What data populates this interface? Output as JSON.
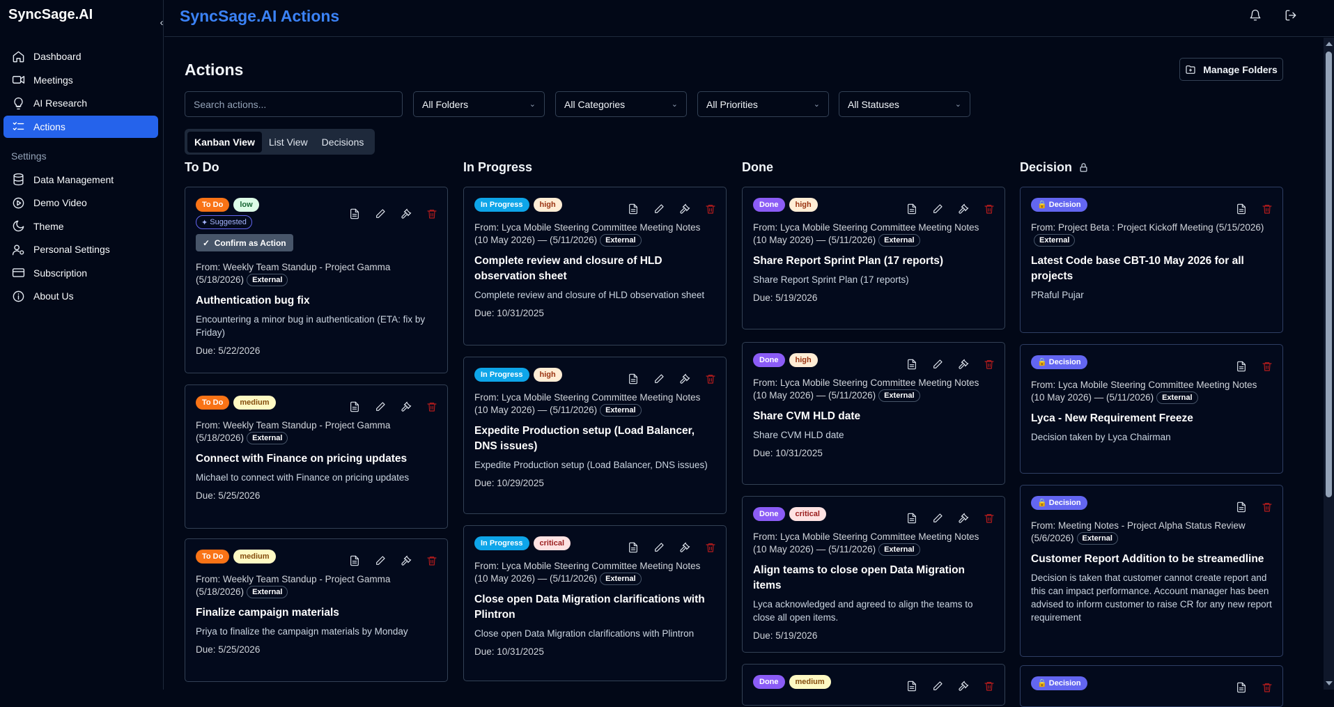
{
  "app": {
    "brand": "SyncSage.AI",
    "title": "SyncSage.AI Actions"
  },
  "nav": [
    {
      "label": "Dashboard"
    },
    {
      "label": "Meetings"
    },
    {
      "label": "AI Research"
    },
    {
      "label": "Actions"
    }
  ],
  "settings_label": "Settings",
  "settings_nav": [
    {
      "label": "Data Management"
    },
    {
      "label": "Demo Video"
    },
    {
      "label": "Theme"
    },
    {
      "label": "Personal Settings"
    },
    {
      "label": "Subscription"
    },
    {
      "label": "About Us"
    }
  ],
  "page": {
    "heading": "Actions",
    "manage_folders": "Manage Folders",
    "search_placeholder": "Search actions..."
  },
  "filters": [
    "All Folders",
    "All Categories",
    "All Priorities",
    "All Statuses"
  ],
  "view_tabs": [
    "Kanban View",
    "List View",
    "Decisions"
  ],
  "columns": [
    "To Do",
    "In Progress",
    "Done",
    "Decision"
  ],
  "cards": {
    "todo": [
      {
        "status": "To Do",
        "priority": "low",
        "suggested": "Suggested",
        "confirm": "Confirm as Action",
        "from": "From: Weekly Team Standup - Project Gamma (5/18/2026)",
        "ext": "External",
        "title": "Authentication bug fix",
        "desc": "Encountering a minor bug in authentication (ETA: fix by Friday)",
        "due": "Due: 5/22/2026"
      },
      {
        "status": "To Do",
        "priority": "medium",
        "from": "From: Weekly Team Standup - Project Gamma (5/18/2026)",
        "ext": "External",
        "title": "Connect with Finance on pricing updates",
        "desc": "Michael to connect with Finance on pricing updates",
        "due": "Due: 5/25/2026"
      },
      {
        "status": "To Do",
        "priority": "medium",
        "from": "From: Weekly Team Standup - Project Gamma (5/18/2026)",
        "ext": "External",
        "title": "Finalize campaign materials",
        "desc": "Priya to finalize the campaign materials by Monday",
        "due": "Due: 5/25/2026"
      }
    ],
    "progress": [
      {
        "status": "In Progress",
        "priority": "high",
        "from": "From: Lyca Mobile Steering Committee Meeting Notes (10 May 2026) — (5/11/2026)",
        "ext": "External",
        "title": "Complete review and closure of HLD observation sheet",
        "desc": "Complete review and closure of HLD observation sheet",
        "due": "Due: 10/31/2025"
      },
      {
        "status": "In Progress",
        "priority": "high",
        "from": "From: Lyca Mobile Steering Committee Meeting Notes (10 May 2026) — (5/11/2026)",
        "ext": "External",
        "title": "Expedite Production setup (Load Balancer, DNS issues)",
        "desc": "Expedite Production setup (Load Balancer, DNS issues)",
        "due": "Due: 10/29/2025"
      },
      {
        "status": "In Progress",
        "priority": "critical",
        "from": "From: Lyca Mobile Steering Committee Meeting Notes (10 May 2026) — (5/11/2026)",
        "ext": "External",
        "title": "Close open Data Migration clarifications with Plintron",
        "desc": "Close open Data Migration clarifications with Plintron",
        "due": "Due: 10/31/2025"
      }
    ],
    "done": [
      {
        "status": "Done",
        "priority": "high",
        "from": "From: Lyca Mobile Steering Committee Meeting Notes (10 May 2026) — (5/11/2026)",
        "ext": "External",
        "title": "Share Report Sprint Plan (17 reports)",
        "desc": "Share Report Sprint Plan (17 reports)",
        "due": "Due: 5/19/2026"
      },
      {
        "status": "Done",
        "priority": "high",
        "from": "From: Lyca Mobile Steering Committee Meeting Notes (10 May 2026) — (5/11/2026)",
        "ext": "External",
        "title": "Share CVM HLD date",
        "desc": "Share CVM HLD date",
        "due": "Due: 10/31/2025"
      },
      {
        "status": "Done",
        "priority": "critical",
        "from": "From: Lyca Mobile Steering Committee Meeting Notes (10 May 2026) — (5/11/2026)",
        "ext": "External",
        "title": "Align teams to close open Data Migration items",
        "desc": "Lyca acknowledged and agreed to align the teams to close all open items.",
        "due": "Due: 5/19/2026"
      },
      {
        "status": "Done",
        "priority": "medium"
      }
    ],
    "decision": [
      {
        "status": "Decision",
        "from": "From: Project Beta : Project Kickoff Meeting (5/15/2026)",
        "ext": "External",
        "title": "Latest Code base CBT-10 May 2026 for all projects",
        "desc": "PRaful Pujar"
      },
      {
        "status": "Decision",
        "from": "From: Lyca Mobile Steering Committee Meeting Notes (10 May 2026) — (5/11/2026)",
        "ext": "External",
        "title": "Lyca - New Requirement Freeze",
        "desc": "Decision taken by Lyca Chairman"
      },
      {
        "status": "Decision",
        "from": "From: Meeting Notes - Project Alpha Status Review (5/6/2026)",
        "ext": "External",
        "title": "Customer Report Addition to be streamedline",
        "desc": "Decision is taken that customer cannot create report and this can impact performance. Account manager has been advised to inform customer to raise CR for any new report requirement"
      },
      {
        "status": "Decision"
      }
    ]
  }
}
